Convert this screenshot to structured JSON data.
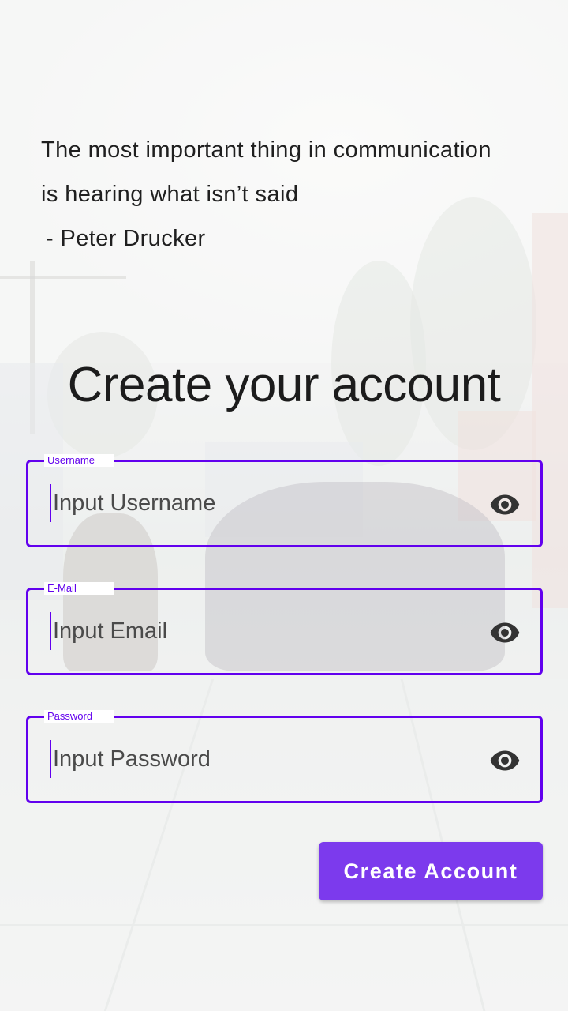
{
  "quote": {
    "text": "The most important thing in communication is hearing what isn’t said",
    "author": " - Peter Drucker"
  },
  "title": "Create your account",
  "form": {
    "username": {
      "label": "Username",
      "placeholder": "Input Username",
      "icon": "eye-icon"
    },
    "email": {
      "label": "E-Mail",
      "placeholder": "Input Email",
      "icon": "eye-icon"
    },
    "password": {
      "label": "Password",
      "placeholder": "Input Password",
      "icon": "eye-icon"
    },
    "submit_label": "Create Account"
  },
  "colors": {
    "accent": "#6200ee",
    "button": "#7c3aed"
  }
}
